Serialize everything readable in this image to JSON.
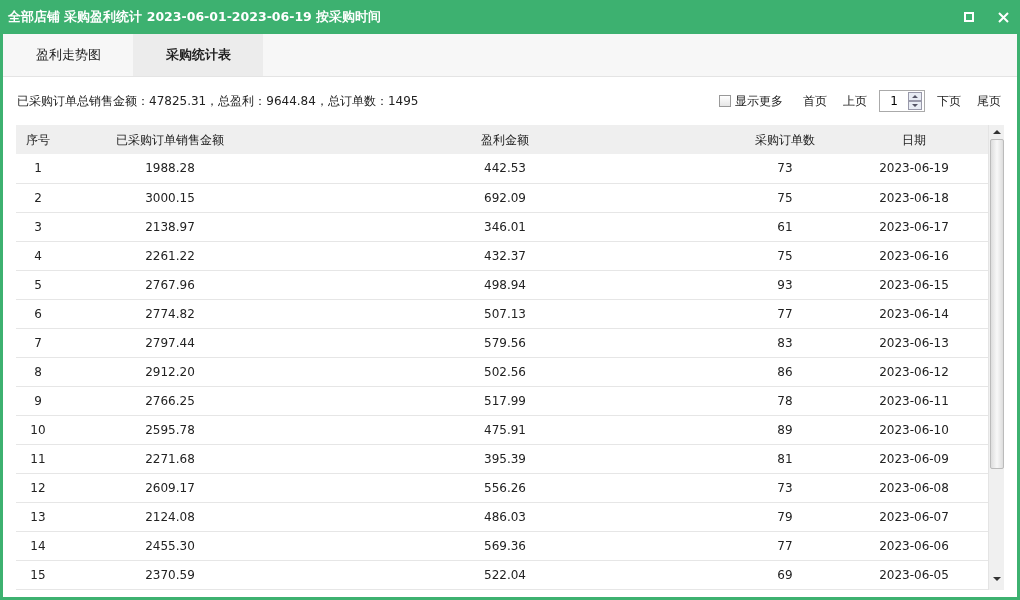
{
  "window": {
    "title": "全部店铺 采购盈利统计 2023-06-01-2023-06-19 按采购时间"
  },
  "tabs": [
    {
      "label": "盈利走势图",
      "selected": false
    },
    {
      "label": "采购统计表",
      "selected": true
    }
  ],
  "summary": "已采购订单总销售金额：47825.31，总盈利：9644.84，总订单数：1495",
  "show_more": {
    "label": "显示更多",
    "checked": false
  },
  "pager": {
    "first": "首页",
    "prev": "上页",
    "page": "1",
    "next": "下页",
    "last": "尾页"
  },
  "table": {
    "columns": [
      "序号",
      "已采购订单销售金额",
      "盈利金额",
      "采购订单数",
      "日期"
    ],
    "rows": [
      [
        "1",
        "1988.28",
        "442.53",
        "73",
        "2023-06-19"
      ],
      [
        "2",
        "3000.15",
        "692.09",
        "75",
        "2023-06-18"
      ],
      [
        "3",
        "2138.97",
        "346.01",
        "61",
        "2023-06-17"
      ],
      [
        "4",
        "2261.22",
        "432.37",
        "75",
        "2023-06-16"
      ],
      [
        "5",
        "2767.96",
        "498.94",
        "93",
        "2023-06-15"
      ],
      [
        "6",
        "2774.82",
        "507.13",
        "77",
        "2023-06-14"
      ],
      [
        "7",
        "2797.44",
        "579.56",
        "83",
        "2023-06-13"
      ],
      [
        "8",
        "2912.20",
        "502.56",
        "86",
        "2023-06-12"
      ],
      [
        "9",
        "2766.25",
        "517.99",
        "78",
        "2023-06-11"
      ],
      [
        "10",
        "2595.78",
        "475.91",
        "89",
        "2023-06-10"
      ],
      [
        "11",
        "2271.68",
        "395.39",
        "81",
        "2023-06-09"
      ],
      [
        "12",
        "2609.17",
        "556.26",
        "73",
        "2023-06-08"
      ],
      [
        "13",
        "2124.08",
        "486.03",
        "79",
        "2023-06-07"
      ],
      [
        "14",
        "2455.30",
        "569.36",
        "77",
        "2023-06-06"
      ],
      [
        "15",
        "2370.59",
        "522.04",
        "69",
        "2023-06-05"
      ]
    ]
  }
}
